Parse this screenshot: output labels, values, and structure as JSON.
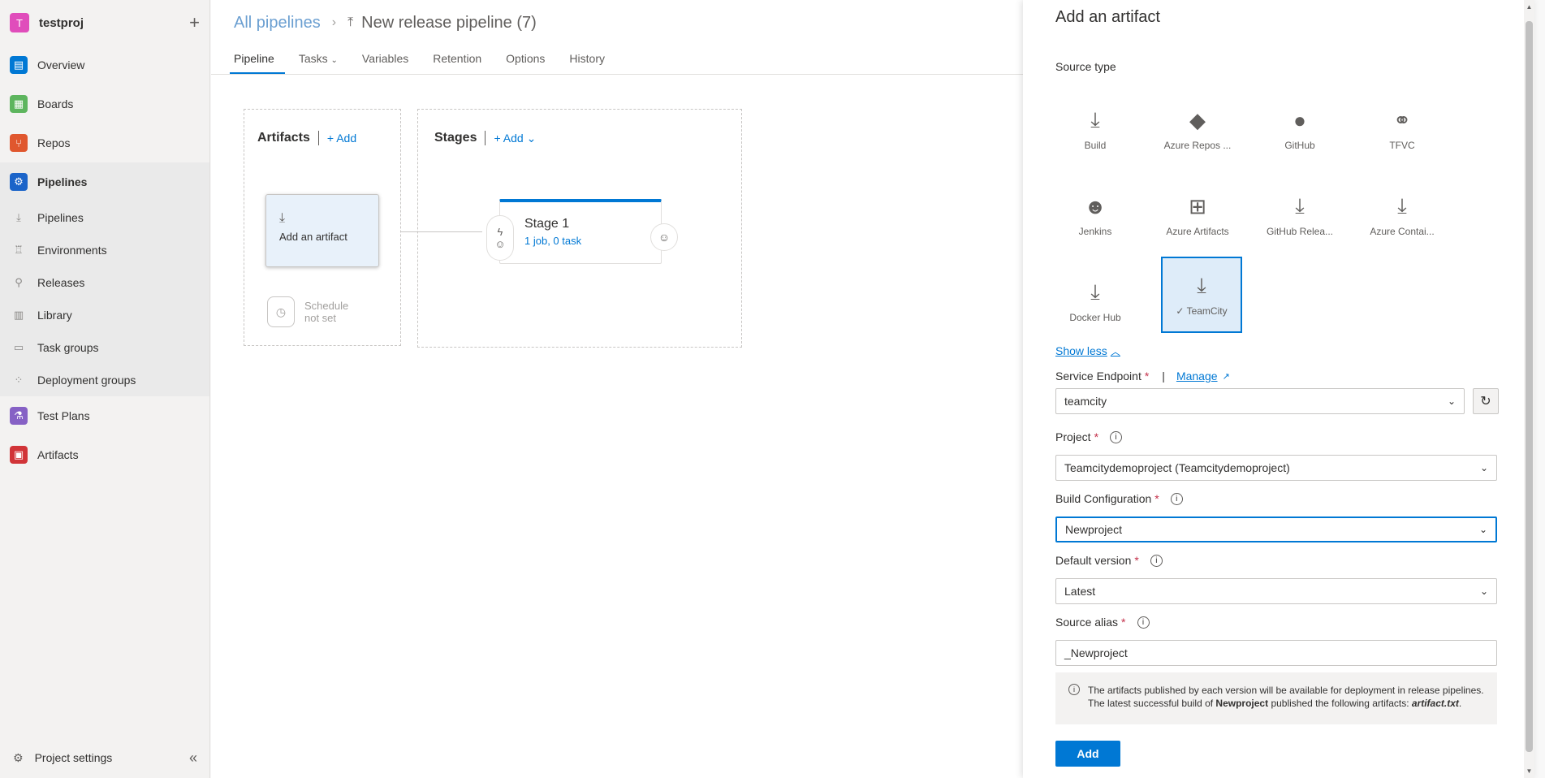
{
  "project": {
    "initial": "T",
    "name": "testproj"
  },
  "nav": {
    "items": [
      {
        "label": "Overview",
        "color": "#0078d4"
      },
      {
        "label": "Boards",
        "color": "#5db55e"
      },
      {
        "label": "Repos",
        "color": "#e0572e"
      },
      {
        "label": "Pipelines",
        "color": "#1b64c9"
      }
    ],
    "pipelines_sub": [
      "Pipelines",
      "Environments",
      "Releases",
      "Library",
      "Task groups",
      "Deployment groups"
    ],
    "items2": [
      {
        "label": "Test Plans",
        "color": "#8661c5"
      },
      {
        "label": "Artifacts",
        "color": "#d13438"
      }
    ],
    "settings": "Project settings"
  },
  "breadcrumb": {
    "root": "All pipelines",
    "title": "New release pipeline (7)"
  },
  "tabs": [
    "Pipeline",
    "Tasks",
    "Variables",
    "Retention",
    "Options",
    "History"
  ],
  "pipeline": {
    "artifacts_title": "Artifacts",
    "stages_title": "Stages",
    "add_label": "Add",
    "artifact_card": "Add an artifact",
    "schedule": [
      "Schedule",
      "not set"
    ],
    "stage_name": "Stage 1",
    "stage_sub": "1 job, 0 task"
  },
  "panel": {
    "title": "Add an artifact",
    "source_type_label": "Source type",
    "sources": [
      {
        "label": "Build",
        "icon": "build-icon"
      },
      {
        "label": "Azure Repos ...",
        "icon": "azure-repos-icon"
      },
      {
        "label": "GitHub",
        "icon": "github-icon"
      },
      {
        "label": "TFVC",
        "icon": "tfvc-icon"
      },
      {
        "label": "Jenkins",
        "icon": "jenkins-icon"
      },
      {
        "label": "Azure Artifacts",
        "icon": "gift-icon"
      },
      {
        "label": "GitHub Relea...",
        "icon": "build-icon"
      },
      {
        "label": "Azure Contai...",
        "icon": "build-icon"
      },
      {
        "label": "Docker Hub",
        "icon": "build-icon"
      },
      {
        "label": "TeamCity",
        "icon": "build-icon",
        "selected": true
      }
    ],
    "show_less": "Show less",
    "service_endpoint_label": "Service Endpoint",
    "manage_label": "Manage",
    "service_endpoint_value": "teamcity",
    "project_label": "Project",
    "project_value": "Teamcitydemoproject (Teamcitydemoproject)",
    "build_config_label": "Build Configuration",
    "build_config_value": "Newproject",
    "default_version_label": "Default version",
    "default_version_value": "Latest",
    "source_alias_label": "Source alias",
    "source_alias_value": "_Newproject",
    "note_line1": "The artifacts published by each version will be available for deployment in release pipelines.",
    "note_line2_a": "The latest successful build of ",
    "note_line2_b": "Newproject",
    "note_line2_c": " published the following artifacts: ",
    "note_line2_d": "artifact.txt",
    "note_line2_e": ".",
    "add_button": "Add",
    "accent": "#0078d4"
  }
}
